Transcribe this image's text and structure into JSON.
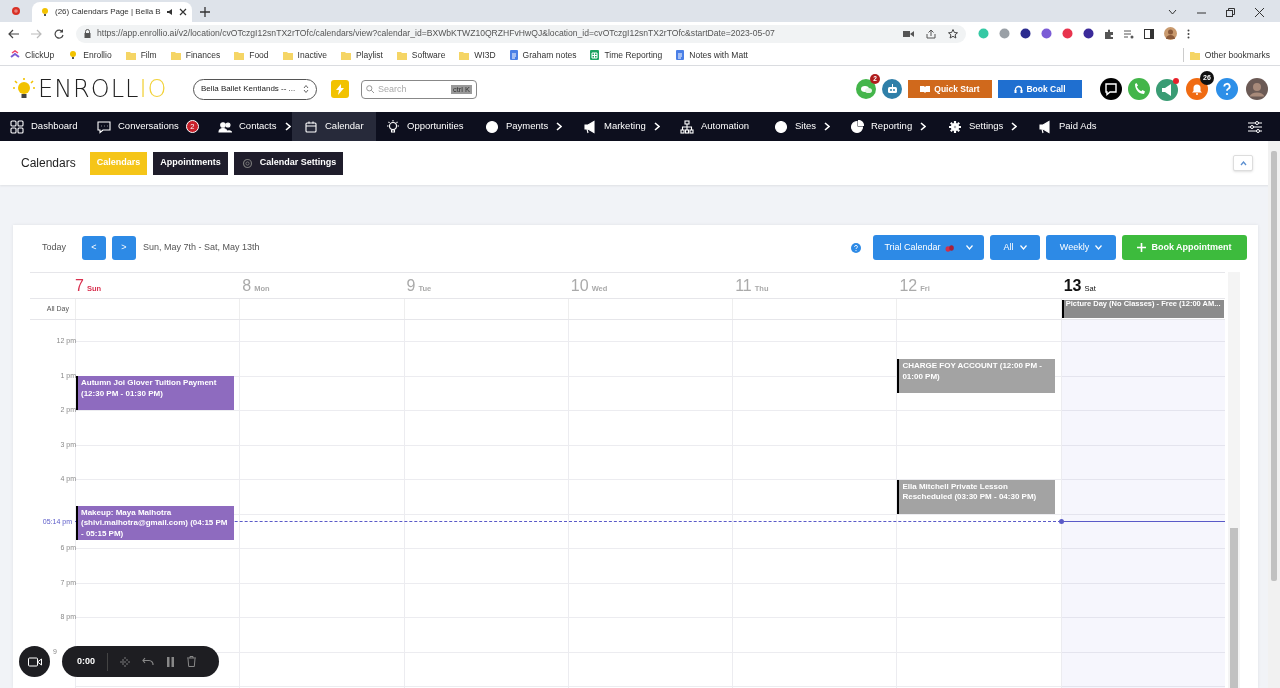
{
  "browser": {
    "tab_title": "(26) Calendars Page | Bella B",
    "url": "https://app.enrollio.ai/v2/location/cvOTczgI12snTX2rTOfc/calendars/view?calendar_id=BXWbKTWZ10QRZHFvHwQJ&location_id=cvOTczgI12snTX2rTOfc&startDate=2023-05-07",
    "bookmarks": [
      {
        "label": "ClickUp",
        "kind": "site"
      },
      {
        "label": "Enrollio",
        "kind": "bulb"
      },
      {
        "label": "Film",
        "kind": "folder"
      },
      {
        "label": "Finances",
        "kind": "folder"
      },
      {
        "label": "Food",
        "kind": "folder"
      },
      {
        "label": "Inactive",
        "kind": "folder"
      },
      {
        "label": "Playlist",
        "kind": "folder"
      },
      {
        "label": "Software",
        "kind": "folder"
      },
      {
        "label": "WI3D",
        "kind": "folder"
      },
      {
        "label": "Graham notes",
        "kind": "doc"
      },
      {
        "label": "Time Reporting",
        "kind": "sheet"
      },
      {
        "label": "Notes with Matt",
        "kind": "doc"
      }
    ],
    "other_bookmarks": "Other bookmarks"
  },
  "header": {
    "logo": "ENROLL",
    "logo_accent": "IO",
    "location": "Bella Ballet Kentlands -- ...",
    "search": {
      "placeholder": "Search",
      "shortcut": "ctrl K"
    },
    "chat_badge": "2",
    "quick_start": "Quick Start",
    "book_call": "Book Call",
    "bell_badge": "26"
  },
  "nav": [
    {
      "label": "Dashboard",
      "submenu": false,
      "selected": false
    },
    {
      "label": "Conversations",
      "badge": "2",
      "submenu": false,
      "selected": false
    },
    {
      "label": "Contacts",
      "submenu": true,
      "selected": false
    },
    {
      "label": "Calendar",
      "submenu": false,
      "selected": true
    },
    {
      "label": "Opportunities",
      "submenu": false,
      "selected": false
    },
    {
      "label": "Payments",
      "submenu": true,
      "selected": false
    },
    {
      "label": "Marketing",
      "submenu": true,
      "selected": false
    },
    {
      "label": "Automation",
      "submenu": false,
      "selected": false
    },
    {
      "label": "Sites",
      "submenu": true,
      "selected": false
    },
    {
      "label": "Reporting",
      "submenu": true,
      "selected": false
    },
    {
      "label": "Settings",
      "submenu": true,
      "selected": false
    },
    {
      "label": "Paid Ads",
      "submenu": false,
      "selected": false
    }
  ],
  "subheader": {
    "title": "Calendars",
    "tabs": [
      {
        "label": "Calendars",
        "selected": true
      },
      {
        "label": "Appointments",
        "selected": false
      },
      {
        "label": "Calendar Settings",
        "selected": false
      }
    ]
  },
  "toolbar": {
    "today": "Today",
    "prev": "<",
    "next": ">",
    "range": "Sun, May 7th - Sat, May 13th",
    "calendar": "Trial Calendar",
    "filter": "All",
    "view": "Weekly",
    "book": "Book Appointment"
  },
  "all_day_label": "All Day",
  "days": [
    {
      "number": "7",
      "name": "Sun",
      "selected": true,
      "today": false,
      "events": [
        {
          "title": "Autumn Joi Glover Tuition Payment (12:30 PM - 01:30 PM)",
          "color": "#8e6bbf"
        },
        {
          "title": "Makeup: Maya Malhotra (shivi.malhotra@gmail.com) (04:15 PM - 05:15 PM)",
          "color": "#8e6bbf"
        }
      ]
    },
    {
      "number": "8",
      "name": "Mon",
      "selected": false,
      "today": false
    },
    {
      "number": "9",
      "name": "Tue",
      "selected": false,
      "today": false
    },
    {
      "number": "10",
      "name": "Wed",
      "selected": false,
      "today": false
    },
    {
      "number": "11",
      "name": "Thu",
      "selected": false,
      "today": false
    },
    {
      "number": "12",
      "name": "Fri",
      "selected": false,
      "today": false,
      "events": [
        {
          "title": "CHARGE FOY ACCOUNT (12:00 PM - 01:00 PM)",
          "color": "#a3a3a3"
        },
        {
          "title": "Ella Mitchell Private Lesson Rescheduled (03:30 PM - 04:30 PM)",
          "color": "#a3a3a3"
        }
      ]
    },
    {
      "number": "13",
      "name": "Sat",
      "selected": false,
      "today": true,
      "all_day": [
        {
          "title": "Picture Day (No Classes) - Free (12:00 AM...",
          "color": "#8c8c8c"
        }
      ]
    }
  ],
  "time_labels": [
    {
      "text": "12 pm",
      "kind": "hour"
    },
    {
      "text": "1 pm",
      "kind": "hour"
    },
    {
      "text": "2 pm",
      "kind": "hour"
    },
    {
      "text": "3 pm",
      "kind": "hour"
    },
    {
      "text": "4 pm",
      "kind": "hour"
    },
    {
      "text": "05:14 pm",
      "kind": "now"
    },
    {
      "text": "6 pm",
      "kind": "hour"
    },
    {
      "text": "7 pm",
      "kind": "hour"
    },
    {
      "text": "8 pm",
      "kind": "hour"
    },
    {
      "text": "9",
      "kind": "hour"
    }
  ],
  "recorder": {
    "time": "0:00"
  }
}
